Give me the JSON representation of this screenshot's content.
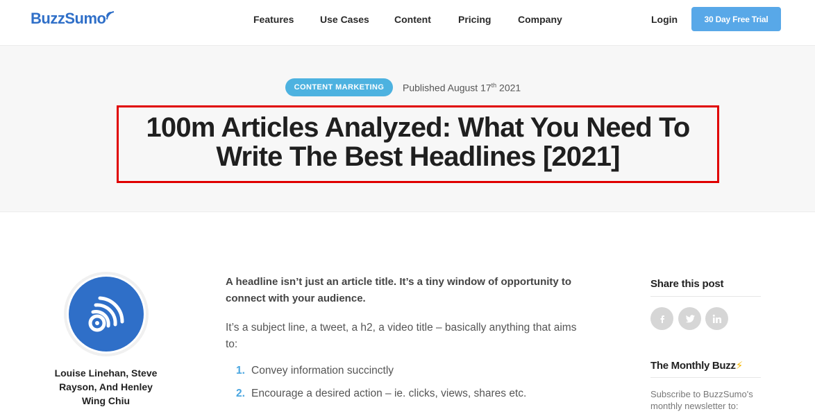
{
  "header": {
    "logo_text": "BuzzSumo",
    "nav": [
      "Features",
      "Use Cases",
      "Content",
      "Pricing",
      "Company"
    ],
    "login_label": "Login",
    "trial_label": "30 Day Free Trial"
  },
  "hero": {
    "category": "CONTENT MARKETING",
    "published_prefix": "Published August 17",
    "published_sup": "th",
    "published_year": " 2021",
    "title": "100m Articles Analyzed: What You Need To Write The Best Headlines [2021]"
  },
  "author": {
    "name": "Louise Linehan, Steve Rayson, And Henley Wing Chiu"
  },
  "article": {
    "lead": "A headline isn’t just an article title. It’s a tiny window of opportunity to connect with your audience.",
    "paragraph": "It’s a subject line, a tweet, a h2, a video title – basically anything that aims to:",
    "list": [
      {
        "num": "1.",
        "text": "Convey information succinctly"
      },
      {
        "num": "2.",
        "text": "Encourage a desired action – ie. clicks, views, shares etc."
      }
    ]
  },
  "sidebar": {
    "share_title": "Share this post",
    "social_icons": [
      "facebook-icon",
      "twitter-icon",
      "linkedin-icon"
    ],
    "newsletter_title": "The Monthly Buzz",
    "newsletter_emoji": "⚡",
    "subscribe_text": "Subscribe to BuzzSumo's monthly newsletter to:"
  },
  "colors": {
    "brand": "#2f6fc8",
    "accent": "#58a8e8",
    "pill": "#4db2e0",
    "highlight_border": "#e00000"
  }
}
